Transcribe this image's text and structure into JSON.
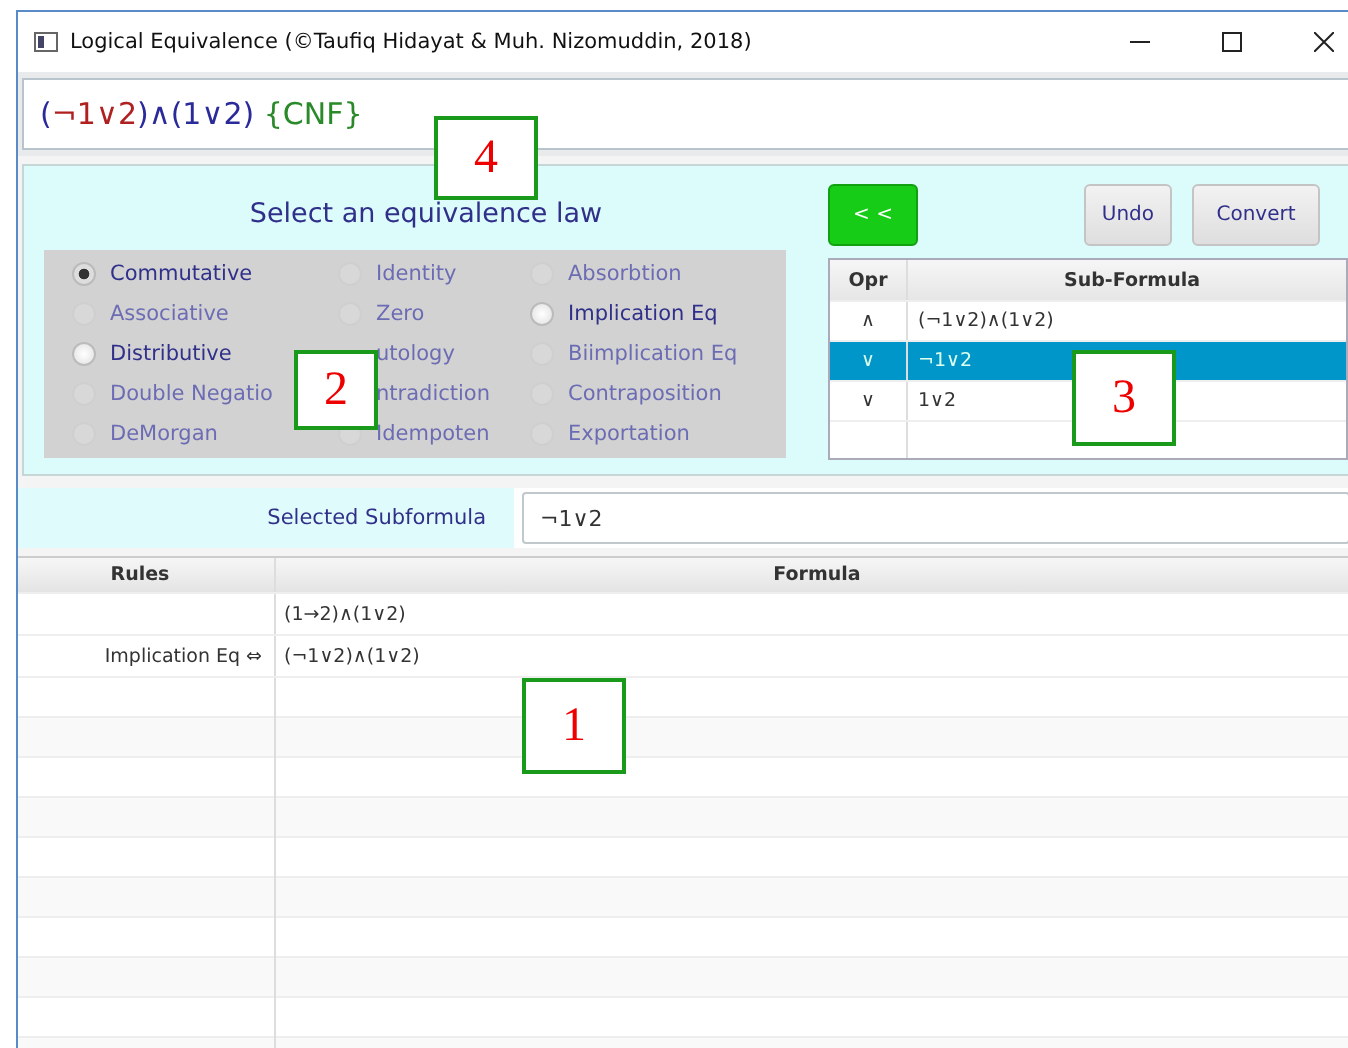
{
  "window": {
    "title": "Logical Equivalence (©Taufiq Hidayat & Muh. Nizomuddin, 2018)"
  },
  "formula": [
    {
      "text": "(",
      "color": "#2a2a9a"
    },
    {
      "text": "¬1∨2",
      "color": "#b02020"
    },
    {
      "text": ")∧(1∨2)",
      "color": "#2a2a9a"
    },
    {
      "text": " {CNF}",
      "color": "#2a8a2a"
    }
  ],
  "law_panel": {
    "heading": "Select an equivalence law",
    "laws": [
      {
        "label": "Commutative",
        "selected": true,
        "disabled": false
      },
      {
        "label": "Identity",
        "selected": false,
        "disabled": true
      },
      {
        "label": "Absorbtion",
        "selected": false,
        "disabled": true
      },
      {
        "label": "Associative",
        "selected": false,
        "disabled": true
      },
      {
        "label": "Zero",
        "selected": false,
        "disabled": true
      },
      {
        "label": "Implication Eq",
        "selected": false,
        "disabled": false
      },
      {
        "label": "Distributive",
        "selected": false,
        "disabled": false
      },
      {
        "label": "utology",
        "disabled": true
      },
      {
        "label": "Biimplication Eq",
        "selected": false,
        "disabled": true
      },
      {
        "label": "Double Negatio",
        "selected": false,
        "disabled": true
      },
      {
        "label": "ntradiction",
        "disabled": true
      },
      {
        "label": "Contraposition",
        "selected": false,
        "disabled": true
      },
      {
        "label": "DeMorgan",
        "selected": false,
        "disabled": true
      },
      {
        "label": "Idempoten",
        "selected": false,
        "disabled": true
      },
      {
        "label": "Exportation",
        "selected": false,
        "disabled": true
      }
    ]
  },
  "buttons": {
    "back": "< <",
    "undo": "Undo",
    "convert": "Convert"
  },
  "subformula_table": {
    "columns": [
      "Opr",
      "Sub-Formula"
    ],
    "rows": [
      {
        "opr": "∧",
        "formula": "(¬1∨2)∧(1∨2)",
        "selected": false
      },
      {
        "opr": "∨",
        "formula": "¬1∨2",
        "selected": true
      },
      {
        "opr": "∨",
        "formula": "1∨2",
        "selected": false
      }
    ]
  },
  "selected_subformula": {
    "label": "Selected Subformula",
    "value": "¬1∨2"
  },
  "steps_table": {
    "columns": [
      "Rules",
      "Formula"
    ],
    "rows": [
      {
        "rule": "",
        "formula": "(1→2)∧(1∨2)"
      },
      {
        "rule": "Implication Eq ⇔",
        "formula": "(¬1∨2)∧(1∨2)"
      }
    ]
  },
  "callouts": [
    {
      "number": "4",
      "kind": "top"
    },
    {
      "number": "2",
      "kind": "laws"
    },
    {
      "number": "3",
      "kind": "subtable"
    },
    {
      "number": "1",
      "kind": "steps"
    }
  ]
}
